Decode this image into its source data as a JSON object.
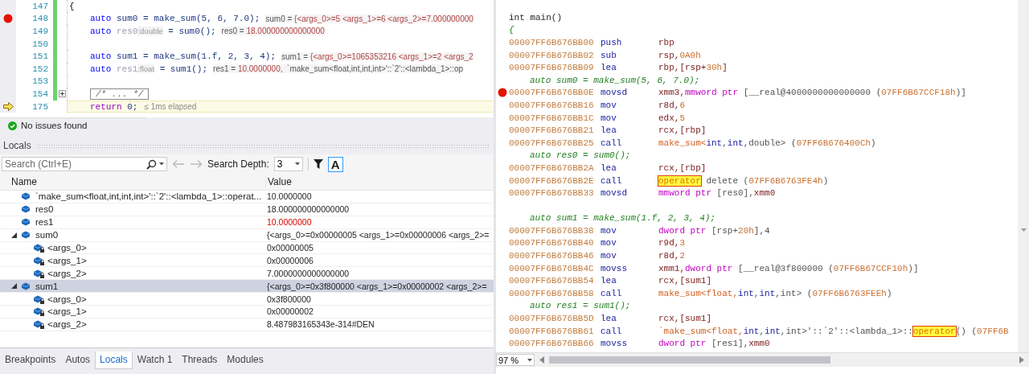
{
  "editor": {
    "lines": [
      {
        "number": "147",
        "breakpoint": false,
        "current": false,
        "modified": true,
        "indented": false,
        "tokens": [
          {
            "text": "{",
            "kind": "plain"
          }
        ]
      },
      {
        "number": "148",
        "breakpoint": true,
        "current": false,
        "modified": true,
        "indented": true,
        "tokens": [
          {
            "text": "auto",
            "kind": "keyword"
          },
          {
            "text": " sum0 = make_sum(5, 6, 7.0);",
            "kind": "name"
          }
        ],
        "datatip": [
          {
            "text": "sum0 = ",
            "kind": "label"
          },
          {
            "text": "{<args_0>=5 <args_1>=6 <args_2>=7.000000000",
            "kind": "value"
          }
        ]
      },
      {
        "number": "149",
        "breakpoint": false,
        "current": false,
        "modified": true,
        "indented": true,
        "tokens": [
          {
            "text": "auto",
            "kind": "keyword"
          },
          {
            "text": " res0",
            "kind": "dim"
          },
          {
            "text": ":double",
            "kind": "hint"
          },
          {
            "text": " = sum0();",
            "kind": "name"
          }
        ],
        "datatip": [
          {
            "text": "res0 = ",
            "kind": "label"
          },
          {
            "text": "18.000000000000000",
            "kind": "value"
          }
        ]
      },
      {
        "number": "150",
        "breakpoint": false,
        "current": false,
        "modified": true
      },
      {
        "number": "151",
        "breakpoint": false,
        "current": false,
        "modified": true,
        "indented": true,
        "tokens": [
          {
            "text": "auto",
            "kind": "keyword"
          },
          {
            "text": " sum1 = make_sum(1.f, 2, 3, 4);",
            "kind": "name"
          }
        ],
        "datatip": [
          {
            "text": "sum1 = ",
            "kind": "label"
          },
          {
            "text": "{<args_0>=1065353216 <args_1>=2 <args_2",
            "kind": "value"
          }
        ]
      },
      {
        "number": "152",
        "breakpoint": false,
        "current": false,
        "modified": true,
        "indented": true,
        "tokens": [
          {
            "text": "auto",
            "kind": "keyword"
          },
          {
            "text": " res1",
            "kind": "dim"
          },
          {
            "text": ":float",
            "kind": "hint"
          },
          {
            "text": " = sum1();",
            "kind": "name"
          }
        ],
        "datatip": [
          {
            "text": "res1 = ",
            "kind": "label"
          },
          {
            "text": "10.0000000,",
            "kind": "value"
          },
          {
            "text": "  `make_sum<float,int,int,int>'::`2'::<lambda_1>::op",
            "kind": "label"
          }
        ]
      },
      {
        "number": "153",
        "breakpoint": false,
        "current": false,
        "modified": true
      },
      {
        "number": "154",
        "breakpoint": false,
        "current": false,
        "modified": true,
        "indented": true,
        "tokens": [
          {
            "text": "/* ... */",
            "kind": "collapsed"
          }
        ]
      },
      {
        "number": "175",
        "breakpoint": false,
        "current": true,
        "modified": false,
        "indented": true,
        "tokens": [
          {
            "text": "return",
            "kind": "control"
          },
          {
            "text": " 0;",
            "kind": "name"
          }
        ],
        "perf_tip": "≤ 1ms elapsed"
      }
    ]
  },
  "status": {
    "text": "No issues found"
  },
  "locals": {
    "title": "Locals",
    "search": {
      "placeholder": "Search (Ctrl+E)"
    },
    "depth_label": "Search Depth:",
    "depth": "3",
    "case_toggle": {
      "label": "A",
      "on": true
    },
    "columns": [
      "Name",
      "Value"
    ],
    "rows": [
      {
        "name": "`make_sum<float,int,int,int>'::`2'::<lambda_1>::operat...",
        "value": "10.0000000",
        "kind": "local",
        "changed": false,
        "selected": false
      },
      {
        "name": "res0",
        "value": "18.000000000000000",
        "kind": "local",
        "changed": false,
        "selected": false
      },
      {
        "name": "res1",
        "value": "10.0000000",
        "kind": "local",
        "changed": true,
        "selected": false
      },
      {
        "name": "sum0",
        "value": "{<args_0>=0x00000005 <args_1>=0x00000006 <args_2>=",
        "kind": "local",
        "changed": false,
        "selected": false,
        "expanded": true,
        "children": [
          {
            "name": "<args_0>",
            "value": "0x00000005",
            "kind": "member",
            "changed": false,
            "selected": false
          },
          {
            "name": "<args_1>",
            "value": "0x00000006",
            "kind": "member",
            "changed": false,
            "selected": false
          },
          {
            "name": "<args_2>",
            "value": "7.0000000000000000",
            "kind": "member",
            "changed": false,
            "selected": false
          }
        ]
      },
      {
        "name": "sum1",
        "value": "{<args_0>=0x3f800000 <args_1>=0x00000002 <args_2>=",
        "kind": "local",
        "changed": false,
        "selected": true,
        "expanded": true,
        "children": [
          {
            "name": "<args_0>",
            "value": "0x3f800000",
            "kind": "member",
            "changed": false,
            "selected": false
          },
          {
            "name": "<args_1>",
            "value": "0x00000002",
            "kind": "member",
            "changed": false,
            "selected": false
          },
          {
            "name": "<args_2>",
            "value": "8.487983165343e-314#DEN",
            "kind": "member",
            "changed": false,
            "selected": false
          }
        ]
      }
    ]
  },
  "tabs": [
    {
      "label": "Breakpoints",
      "selected": false
    },
    {
      "label": "Autos",
      "selected": false
    },
    {
      "label": "Locals",
      "selected": true
    },
    {
      "label": "Watch 1",
      "selected": false
    },
    {
      "label": "Threads",
      "selected": false
    },
    {
      "label": "Modules",
      "selected": false
    }
  ],
  "disassembly": {
    "lines": [
      {
        "kind": "signature",
        "text": "int main()"
      },
      {
        "kind": "source",
        "indented": false,
        "text": "{"
      },
      {
        "kind": "instruction",
        "breakpoint": false,
        "address": "00007FF6B676BB00",
        "mnemonic": "push",
        "operands": [
          {
            "text": "rbp",
            "kind": "reg"
          }
        ]
      },
      {
        "kind": "instruction",
        "breakpoint": false,
        "address": "00007FF6B676BB02",
        "mnemonic": "sub",
        "operands": [
          {
            "text": "rsp,",
            "kind": "reg"
          },
          {
            "text": "0A0h",
            "kind": "num"
          }
        ]
      },
      {
        "kind": "instruction",
        "breakpoint": false,
        "address": "00007FF6B676BB09",
        "mnemonic": "lea",
        "operands": [
          {
            "text": "rbp,[rsp+",
            "kind": "reg"
          },
          {
            "text": "30h",
            "kind": "num"
          },
          {
            "text": "]",
            "kind": "reg"
          }
        ]
      },
      {
        "kind": "source",
        "indented": true,
        "text": "auto sum0 = make_sum(5, 6, 7.0);"
      },
      {
        "kind": "instruction",
        "breakpoint": true,
        "address": "00007FF6B676BB0E",
        "mnemonic": "movsd",
        "operands": [
          {
            "text": "xmm3,",
            "kind": "reg"
          },
          {
            "text": "mmword ptr",
            "kind": "ptr"
          },
          {
            "text": " [__real@4000000000000000 (",
            "kind": "plain"
          },
          {
            "text": "07FF6B67CCF18h",
            "kind": "num"
          },
          {
            "text": ")]",
            "kind": "plain"
          }
        ]
      },
      {
        "kind": "instruction",
        "breakpoint": false,
        "address": "00007FF6B676BB16",
        "mnemonic": "mov",
        "operands": [
          {
            "text": "r8d,",
            "kind": "reg"
          },
          {
            "text": "6",
            "kind": "num"
          }
        ]
      },
      {
        "kind": "instruction",
        "breakpoint": false,
        "address": "00007FF6B676BB1C",
        "mnemonic": "mov",
        "operands": [
          {
            "text": "edx,",
            "kind": "reg"
          },
          {
            "text": "5",
            "kind": "num"
          }
        ]
      },
      {
        "kind": "instruction",
        "breakpoint": false,
        "address": "00007FF6B676BB21",
        "mnemonic": "lea",
        "operands": [
          {
            "text": "rcx,[rbp]",
            "kind": "reg"
          }
        ]
      },
      {
        "kind": "instruction",
        "breakpoint": false,
        "address": "00007FF6B676BB25",
        "mnemonic": "call",
        "operands": [
          {
            "text": "make_sum<",
            "kind": "sym"
          },
          {
            "text": "int",
            "kind": "type"
          },
          {
            "text": ",",
            "kind": "plain"
          },
          {
            "text": "int",
            "kind": "type"
          },
          {
            "text": ",double> (",
            "kind": "plain"
          },
          {
            "text": "07FF6B676400Ch",
            "kind": "num"
          },
          {
            "text": ")",
            "kind": "plain"
          }
        ]
      },
      {
        "kind": "source",
        "indented": true,
        "text": "auto res0 = sum0();"
      },
      {
        "kind": "instruction",
        "breakpoint": false,
        "address": "00007FF6B676BB2A",
        "mnemonic": "lea",
        "operands": [
          {
            "text": "rcx,[rbp]",
            "kind": "reg"
          }
        ]
      },
      {
        "kind": "instruction",
        "breakpoint": false,
        "address": "00007FF6B676BB2E",
        "mnemonic": "call",
        "operands": [
          {
            "text": "operator",
            "kind": "highlight"
          },
          {
            "text": " delete (",
            "kind": "plain"
          },
          {
            "text": "07FF6B6763FE4h",
            "kind": "num"
          },
          {
            "text": ")",
            "kind": "plain"
          }
        ]
      },
      {
        "kind": "instruction",
        "breakpoint": false,
        "address": "00007FF6B676BB33",
        "mnemonic": "movsd",
        "operands": [
          {
            "text": "mmword ptr",
            "kind": "ptr"
          },
          {
            "text": " [res0],",
            "kind": "plain"
          },
          {
            "text": "xmm0",
            "kind": "reg"
          }
        ]
      },
      {
        "kind": "blank"
      },
      {
        "kind": "source",
        "indented": true,
        "text": "auto sum1 = make_sum(1.f, 2, 3, 4);"
      },
      {
        "kind": "instruction",
        "breakpoint": false,
        "address": "00007FF6B676BB38",
        "mnemonic": "mov",
        "operands": [
          {
            "text": "dword ptr",
            "kind": "ptr"
          },
          {
            "text": " [rsp+",
            "kind": "plain"
          },
          {
            "text": "20h",
            "kind": "num"
          },
          {
            "text": "],4",
            "kind": "plain"
          }
        ]
      },
      {
        "kind": "instruction",
        "breakpoint": false,
        "address": "00007FF6B676BB40",
        "mnemonic": "mov",
        "operands": [
          {
            "text": "r9d,",
            "kind": "reg"
          },
          {
            "text": "3",
            "kind": "num"
          }
        ]
      },
      {
        "kind": "instruction",
        "breakpoint": false,
        "address": "00007FF6B676BB46",
        "mnemonic": "mov",
        "operands": [
          {
            "text": "r8d,",
            "kind": "reg"
          },
          {
            "text": "2",
            "kind": "num"
          }
        ]
      },
      {
        "kind": "instruction",
        "breakpoint": false,
        "address": "00007FF6B676BB4C",
        "mnemonic": "movss",
        "operands": [
          {
            "text": "xmm1,",
            "kind": "reg"
          },
          {
            "text": "dword ptr",
            "kind": "ptr"
          },
          {
            "text": " [__real@3f800000 (",
            "kind": "plain"
          },
          {
            "text": "07FF6B67CCF10h",
            "kind": "num"
          },
          {
            "text": ")]",
            "kind": "plain"
          }
        ]
      },
      {
        "kind": "instruction",
        "breakpoint": false,
        "address": "00007FF6B676BB54",
        "mnemonic": "lea",
        "operands": [
          {
            "text": "rcx,[sum1]",
            "kind": "reg"
          }
        ]
      },
      {
        "kind": "instruction",
        "breakpoint": false,
        "address": "00007FF6B676BB58",
        "mnemonic": "call",
        "operands": [
          {
            "text": "make_sum<float,",
            "kind": "sym"
          },
          {
            "text": "int",
            "kind": "type"
          },
          {
            "text": ",",
            "kind": "plain"
          },
          {
            "text": "int",
            "kind": "type"
          },
          {
            "text": ",int> (",
            "kind": "plain"
          },
          {
            "text": "07FF6B6763FEEh",
            "kind": "num"
          },
          {
            "text": ")",
            "kind": "plain"
          }
        ]
      },
      {
        "kind": "source",
        "indented": true,
        "text": "auto res1 = sum1();"
      },
      {
        "kind": "instruction",
        "breakpoint": false,
        "address": "00007FF6B676BB5D",
        "mnemonic": "lea",
        "operands": [
          {
            "text": "rcx,[sum1]",
            "kind": "reg"
          }
        ]
      },
      {
        "kind": "instruction",
        "breakpoint": false,
        "address": "00007FF6B676BB61",
        "mnemonic": "call",
        "operands": [
          {
            "text": "`make_sum<float,",
            "kind": "sym"
          },
          {
            "text": "int",
            "kind": "type"
          },
          {
            "text": ",",
            "kind": "plain"
          },
          {
            "text": "int",
            "kind": "type"
          },
          {
            "text": ",int>'::`2'::<lambda_1>::",
            "kind": "plain"
          },
          {
            "text": "operator",
            "kind": "highlight"
          },
          {
            "text": "() (",
            "kind": "plain"
          },
          {
            "text": "07FF6B",
            "kind": "num"
          }
        ]
      },
      {
        "kind": "instruction",
        "breakpoint": false,
        "address": "00007FF6B676BB66",
        "mnemonic": "movss",
        "operands": [
          {
            "text": "dword ptr",
            "kind": "ptr"
          },
          {
            "text": " [res1],",
            "kind": "plain"
          },
          {
            "text": "xmm0",
            "kind": "reg"
          }
        ]
      }
    ],
    "zoom": "97 %"
  }
}
